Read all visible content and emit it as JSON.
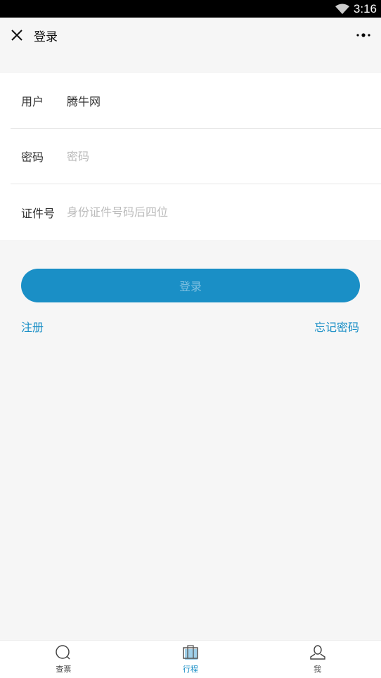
{
  "status_bar": {
    "time": "3:16",
    "icons": [
      "wifi-icon"
    ]
  },
  "header": {
    "title": "登录",
    "close_icon": "close-icon",
    "more_icon": "more-icon"
  },
  "form": {
    "username": {
      "label": "用户",
      "value": "腾牛网"
    },
    "password": {
      "label": "密码",
      "placeholder": "密码"
    },
    "id_number": {
      "label": "证件号",
      "placeholder": "身份证件号码后四位"
    }
  },
  "login_button": "登录",
  "links": {
    "register": "注册",
    "forgot": "忘记密码"
  },
  "tabbar": {
    "items": [
      {
        "label": "查票",
        "icon": "search-icon"
      },
      {
        "label": "行程",
        "icon": "suitcase-icon",
        "active": true
      },
      {
        "label": "我",
        "icon": "user-icon"
      }
    ]
  },
  "colors": {
    "accent": "#1a8fc6"
  }
}
